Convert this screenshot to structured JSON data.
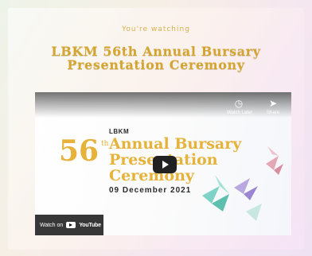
{
  "header": {
    "watching_label": "You're watching",
    "title_line1": "LBKM 56th Annual Bursary",
    "title_line2": "Presentation Ceremony"
  },
  "player": {
    "poster": {
      "org": "LBKM",
      "number": "56",
      "ordinal_suffix": "th",
      "line1": "Annual Bursary",
      "line2": "Presentation",
      "line3": "Ceremony",
      "date": "09 December 2021"
    },
    "controls": {
      "watch_later_label": "Watch Later",
      "share_label": "Share"
    },
    "watch_on_label": "Watch on",
    "youtube_label": "YouTube"
  },
  "colors": {
    "title_gold": "#d5a62f",
    "poster_gold": "#e6b23a"
  }
}
